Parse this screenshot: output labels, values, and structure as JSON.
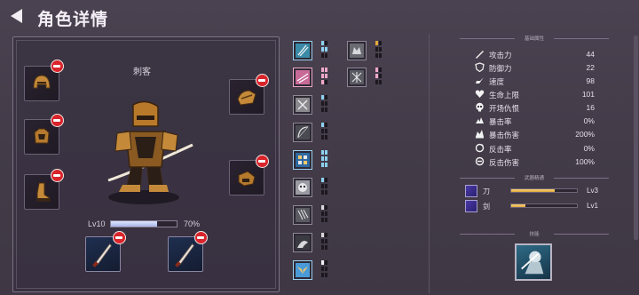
{
  "header": {
    "title": "角色详情"
  },
  "character": {
    "class_name": "刺客",
    "level_label": "Lv10",
    "xp_percent_label": "70%",
    "xp_progress": 0.7
  },
  "colors": {
    "accent_gold": "#e4a93a",
    "badge_red": "#d8242a",
    "xp_fill": "#c8d0f4",
    "skill_blue": "#8cd2f0",
    "skill_pink": "#f0a8c8"
  },
  "equipment": [
    {
      "slot": "helmet",
      "icon": "helmet-icon"
    },
    {
      "slot": "armor",
      "icon": "chest-armor-icon"
    },
    {
      "slot": "boots",
      "icon": "boot-icon"
    },
    {
      "slot": "shoulder",
      "icon": "shoulder-guard-icon"
    },
    {
      "slot": "gloves",
      "icon": "gauntlet-icon"
    },
    {
      "slot": "weapon-1",
      "icon": "blade-icon"
    },
    {
      "slot": "weapon-2",
      "icon": "blade-icon"
    }
  ],
  "skills": [
    {
      "icon": "twin-blades-skill-icon"
    },
    {
      "icon": "wolf-skill-icon"
    },
    {
      "icon": "arrows-skill-icon"
    },
    {
      "icon": "sword-cross-skill-icon"
    },
    {
      "icon": "grid-skill-icon"
    },
    {
      "icon": "bow-skill-icon"
    },
    {
      "icon": "ice-skill-icon"
    },
    {
      "icon": "mask-skill-icon"
    },
    {
      "icon": "claw-skill-icon"
    },
    {
      "icon": "shadow-skill-icon"
    },
    {
      "icon": "wings-skill-icon"
    }
  ],
  "stats": {
    "section_title": "基础属性",
    "rows": [
      {
        "icon": "sword-icon",
        "label": "攻击力",
        "value": "44"
      },
      {
        "icon": "shield-icon",
        "label": "防御力",
        "value": "22"
      },
      {
        "icon": "speed-icon",
        "label": "速度",
        "value": "98"
      },
      {
        "icon": "heart-icon",
        "label": "生命上限",
        "value": "101"
      },
      {
        "icon": "skull-icon",
        "label": "开场仇恨",
        "value": "16"
      },
      {
        "icon": "crit-icon",
        "label": "暴击率",
        "value": "0%"
      },
      {
        "icon": "crit-damage-icon",
        "label": "暴击伤害",
        "value": "200%"
      },
      {
        "icon": "counter-icon",
        "label": "反击率",
        "value": "0%"
      },
      {
        "icon": "counter-damage-icon",
        "label": "反击伤害",
        "value": "100%"
      }
    ]
  },
  "mastery": {
    "section_title": "武器精通",
    "rows": [
      {
        "icon": "blade-mastery-icon",
        "label": "刀",
        "level": "Lv3",
        "progress": 0.66
      },
      {
        "icon": "sword-mastery-icon",
        "label": "剑",
        "level": "Lv1",
        "progress": 0.22
      }
    ]
  },
  "talent": {
    "section_title": "技能",
    "icon": "shadow-warrior-icon"
  }
}
